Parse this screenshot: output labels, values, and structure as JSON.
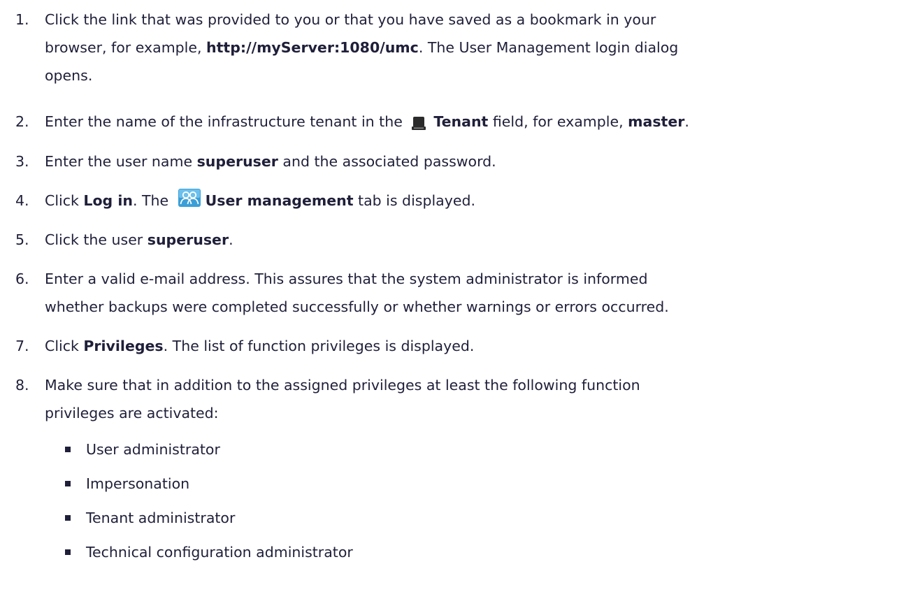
{
  "steps": [
    {
      "num": "1.",
      "l1": "Click the link that was provided to you or that you have saved as a bookmark in your",
      "l2_pre": "browser, for example, ",
      "l2_bold": "http://myServer:1080/umc",
      "l2_post": ". The User Management login dialog",
      "l3": "opens."
    },
    {
      "num": "2.",
      "pre": "Enter the name of the infrastructure tenant in the ",
      "icon": "tenant-icon",
      "bold1": "Tenant",
      "mid": " field, for example, ",
      "bold2": "master",
      "post": "."
    },
    {
      "num": "3.",
      "pre": "Enter the user name ",
      "bold": "superuser",
      "post": " and the associated password."
    },
    {
      "num": "4.",
      "pre": "Click ",
      "bold1": "Log in",
      "mid": ". The ",
      "icon": "users-icon",
      "bold2": "User management",
      "post": " tab is displayed."
    },
    {
      "num": "5.",
      "pre": "Click the user ",
      "bold": "superuser",
      "post": "."
    },
    {
      "num": "6.",
      "l1": "Enter a valid e-mail address. This assures that the system administrator is informed",
      "l2": "whether backups were completed successfully or whether warnings or errors occurred."
    },
    {
      "num": "7.",
      "pre": "Click ",
      "bold": "Privileges",
      "post": ". The list of function privileges is displayed."
    },
    {
      "num": "8.",
      "l1": "Make sure that in addition to the assigned privileges at least the following function",
      "l2": "privileges are activated:",
      "items": [
        "User administrator",
        "Impersonation",
        "Tenant administrator",
        "Technical configuration administrator"
      ]
    }
  ],
  "colors": {
    "text": "#1f1f3a",
    "tenant_icon": "#2b2b2b",
    "users_icon_bg": "#3a9fd8"
  }
}
